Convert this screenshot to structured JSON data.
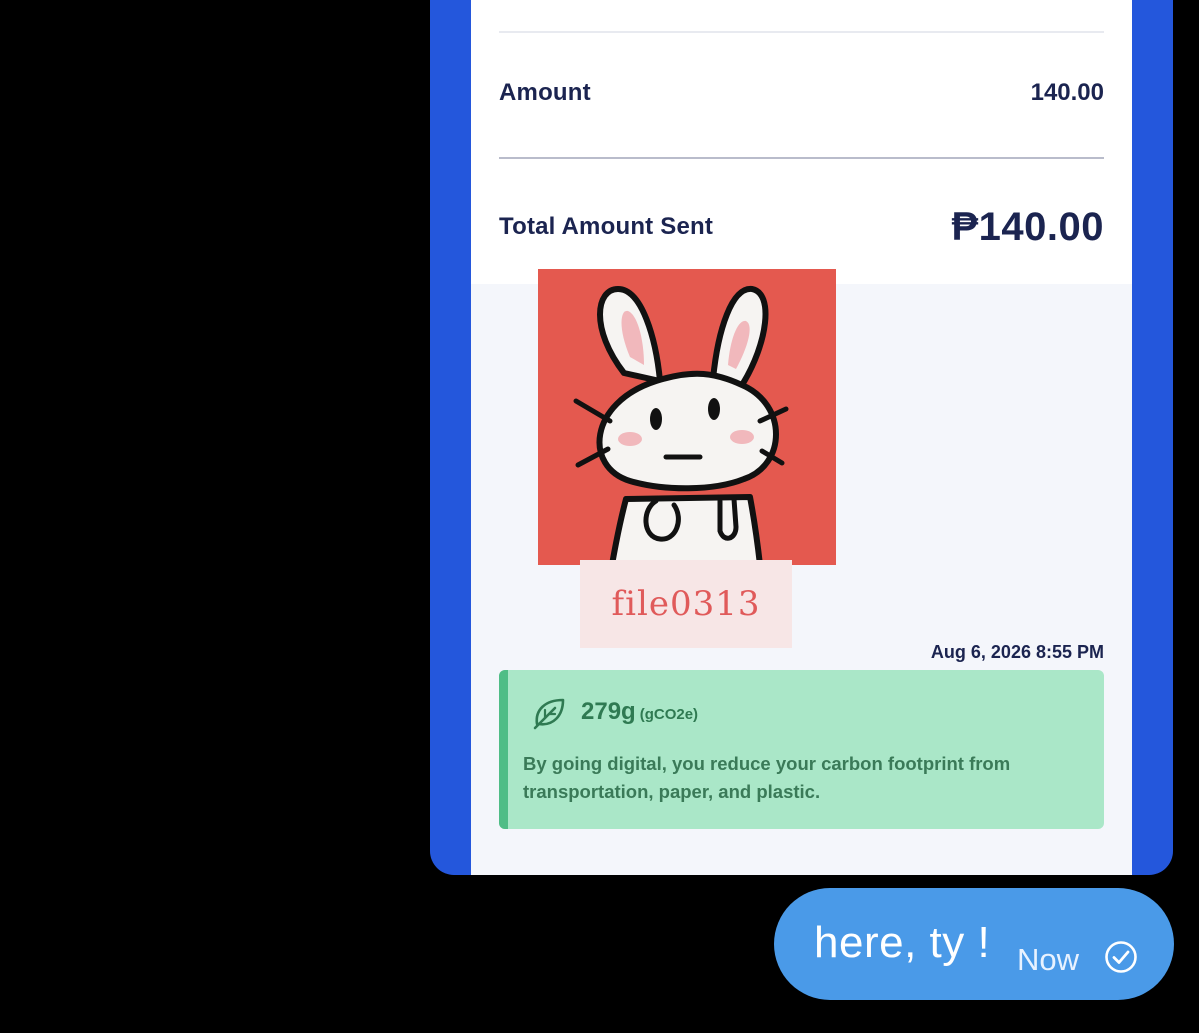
{
  "receipt": {
    "amount_label": "Amount",
    "amount_value": "140.00",
    "total_label": "Total Amount Sent",
    "total_value": "₱140.00",
    "date": "Aug 6, 2026 8:55 PM"
  },
  "sticker": {
    "caption": "file0313",
    "icon": "bunny-sticker",
    "background_color": "#e4594f"
  },
  "carbon": {
    "icon": "leaf-icon",
    "value": "279g",
    "unit": "(gCO2e)",
    "message": "By going digital, you reduce your carbon footprint from transportation, paper, and plastic.",
    "accent_color": "#4fbd86",
    "background_color": "#aae7c8"
  },
  "chat": {
    "message": "here, ty !",
    "time": "Now",
    "status_icon": "check-circle-icon",
    "bubble_color": "#4a9ae8"
  },
  "colors": {
    "frame_blue": "#2457dc",
    "text_navy": "#1b2450"
  }
}
